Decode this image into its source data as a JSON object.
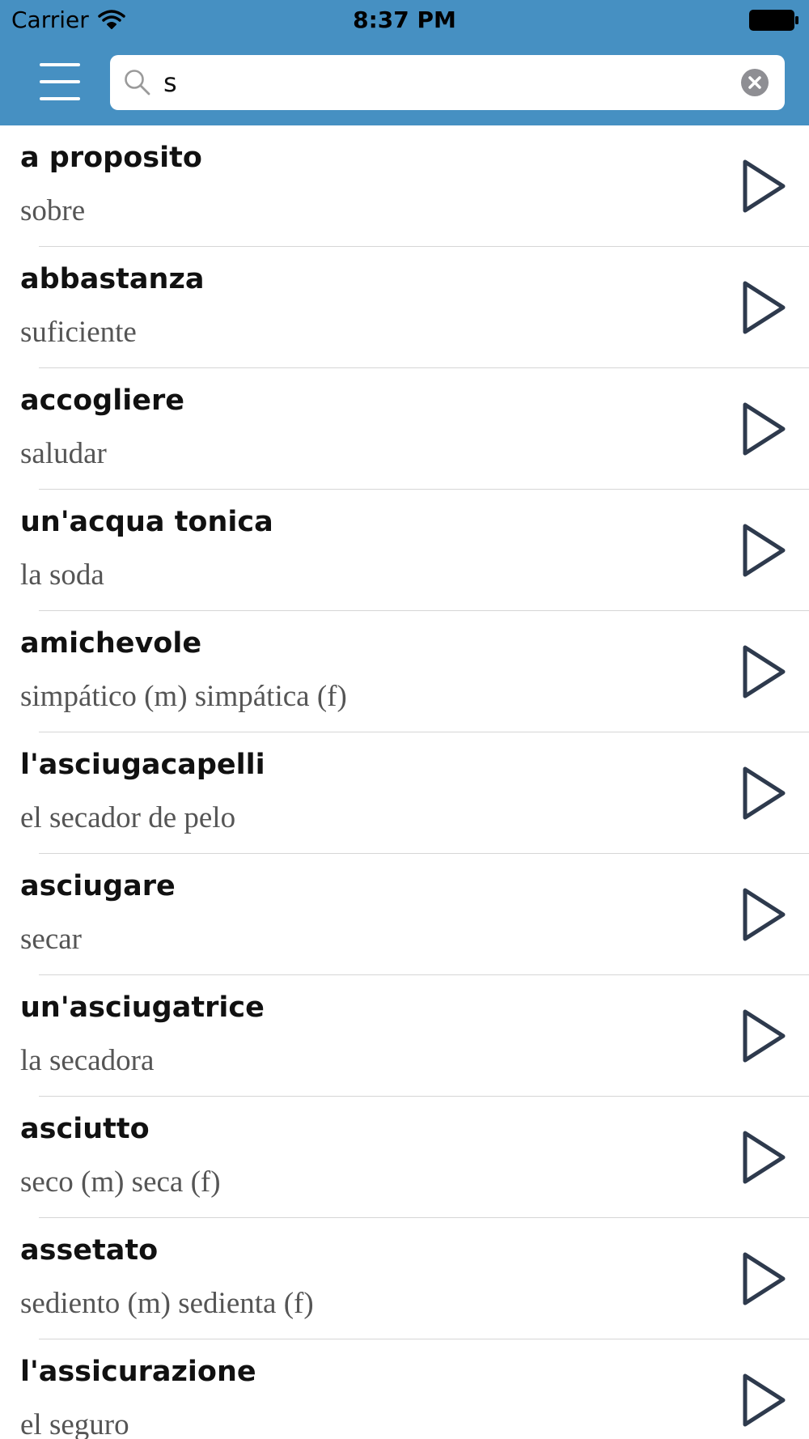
{
  "status_bar": {
    "carrier": "Carrier",
    "time": "8:37 PM",
    "wifi_icon": "wifi-icon",
    "battery_icon": "battery-icon"
  },
  "nav": {
    "menu_icon": "hamburger-menu-icon",
    "search_icon": "search-icon",
    "search_value": "s",
    "clear_icon": "clear-icon",
    "accent_color": "#4690c2"
  },
  "list": {
    "play_icon": "play-icon",
    "items": [
      {
        "term": "a proposito",
        "translation": "sobre"
      },
      {
        "term": "abbastanza",
        "translation": "suficiente"
      },
      {
        "term": "accogliere",
        "translation": "saludar"
      },
      {
        "term": "un'acqua tonica",
        "translation": "la soda"
      },
      {
        "term": "amichevole",
        "translation": "simpático (m)  simpática (f)"
      },
      {
        "term": "l'asciugacapelli",
        "translation": "el secador de pelo"
      },
      {
        "term": "asciugare",
        "translation": "secar"
      },
      {
        "term": "un'asciugatrice",
        "translation": "la secadora"
      },
      {
        "term": "asciutto",
        "translation": "seco (m)  seca (f)"
      },
      {
        "term": "assetato",
        "translation": "sediento (m)  sedienta (f)"
      },
      {
        "term": "l'assicurazione",
        "translation": "el seguro"
      }
    ]
  }
}
